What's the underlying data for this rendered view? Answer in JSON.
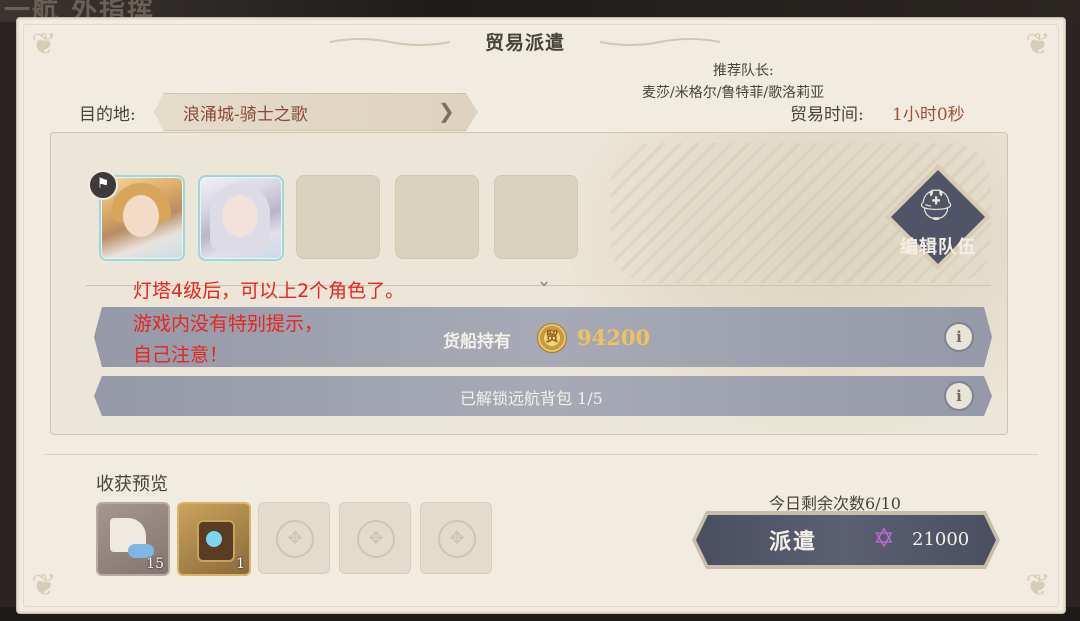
{
  "background": {
    "title_partial": "一航 外指挥"
  },
  "dialog": {
    "title": "贸易派遣",
    "destination_label": "目的地:",
    "destination_value": "浪涌城-骑士之歌",
    "trade_time_label": "贸易时间:",
    "trade_time_value": "1小时0秒"
  },
  "team": {
    "recommended_leader_label": "推荐队长:",
    "recommended_leader_value": "麦莎/米格尔/鲁特菲/歌洛莉亚",
    "edit_team_label": "编辑队伍",
    "members": [
      {
        "slot": 1,
        "filled": true,
        "leader": true,
        "portrait": "blonde-hero-portrait"
      },
      {
        "slot": 2,
        "filled": true,
        "leader": false,
        "portrait": "silver-hair-hero-portrait"
      },
      {
        "slot": 3,
        "filled": false
      },
      {
        "slot": 4,
        "filled": false
      },
      {
        "slot": 5,
        "filled": false
      }
    ]
  },
  "annotation": {
    "line1": "灯塔4级后，可以上2个角色了。",
    "line2": "游戏内没有特别提示，",
    "line3": "自己注意！",
    "color": "#e8241c"
  },
  "cargo": {
    "label": "货船持有",
    "coin_glyph": "贸",
    "value": "94200",
    "info_glyph": "i"
  },
  "backpack": {
    "label": "已解锁远航背包  1/5",
    "info_glyph": "i"
  },
  "harvest": {
    "label": "收获预览",
    "items": [
      {
        "name": "sail-item",
        "count": "15"
      },
      {
        "name": "compass-item",
        "count": "1"
      },
      {
        "name": "empty"
      },
      {
        "name": "empty"
      },
      {
        "name": "empty"
      }
    ]
  },
  "dispatch": {
    "remaining_label": "今日剩余次数6/10",
    "button_label": "派遣",
    "cost_icon": "star-crystal-icon",
    "cost_value": "21000"
  },
  "colors": {
    "panel_bg": "#f1ecdf",
    "accent_text": "#8a4a3a",
    "bar_bg": "#9a9ead",
    "gold": "#f0c25a"
  }
}
